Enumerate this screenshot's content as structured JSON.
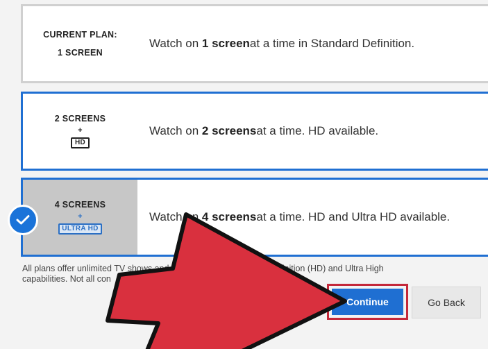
{
  "plans": [
    {
      "title_line1": "CURRENT PLAN:",
      "title_line2": "1 SCREEN",
      "desc_pre": "Watch on ",
      "desc_bold": "1 screen",
      "desc_post": " at a time in Standard Definition."
    },
    {
      "title_line1": "2 SCREENS",
      "plus": "+",
      "badge": "HD",
      "desc_pre": "Watch on ",
      "desc_bold": "2 screens",
      "desc_post": " at a time. HD available."
    },
    {
      "title_line1": "4 SCREENS",
      "plus": "+",
      "badge": "ULTRA HD",
      "desc_pre": "Watch on ",
      "desc_bold": "4 screens",
      "desc_post": " at a time. HD and Ultra HD available.",
      "selected": true
    }
  ],
  "footnote": "All plans offer unlimited TV shows and mo                                    es as you want. High Definition (HD) and Ultra High\ncapabilities. Not all con",
  "buttons": {
    "continue": "Continue",
    "go_back": "Go Back"
  },
  "colors": {
    "accent_blue": "#1f6fd2",
    "arrow_red": "#d9303e",
    "highlight_red": "#c4283a"
  },
  "icons": {
    "selected": "checkmark-icon",
    "overlay": "red-arrow-pointer"
  }
}
